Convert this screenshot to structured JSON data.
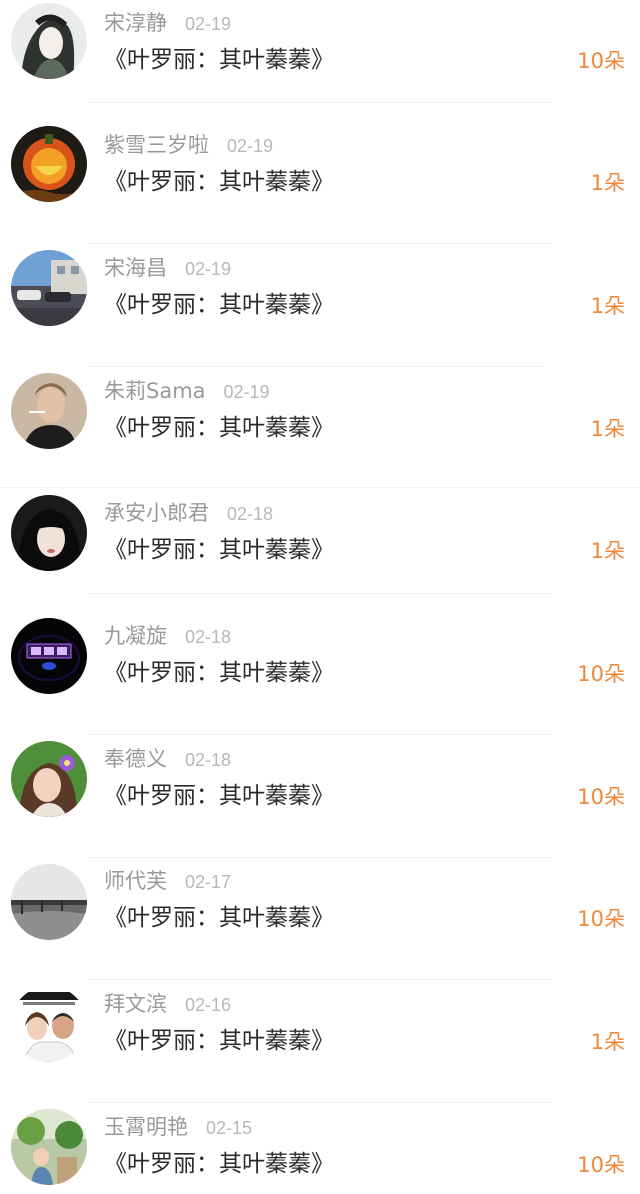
{
  "items": [
    {
      "name": "宋淳静",
      "date": "02-19",
      "title": "《叶罗丽：其叶蓁蓁》",
      "amount": "10朵",
      "avatar": "avatar-girl-illustration-icon"
    },
    {
      "name": "紫雪三岁啦",
      "date": "02-19",
      "title": "《叶罗丽：其叶蓁蓁》",
      "amount": "1朵",
      "avatar": "avatar-pumpkin-lantern-icon"
    },
    {
      "name": "宋海昌",
      "date": "02-19",
      "title": "《叶罗丽：其叶蓁蓁》",
      "amount": "1朵",
      "avatar": "avatar-cars-building-icon"
    },
    {
      "name": "朱莉Sama",
      "date": "02-19",
      "title": "《叶罗丽：其叶蓁蓁》",
      "amount": "1朵",
      "avatar": "avatar-woman-smoking-icon"
    },
    {
      "name": "承安小郎君",
      "date": "02-18",
      "title": "《叶罗丽：其叶蓁蓁》",
      "amount": "1朵",
      "avatar": "avatar-dark-hair-girl-icon"
    },
    {
      "name": "九凝旋",
      "date": "02-18",
      "title": "《叶罗丽：其叶蓁蓁》",
      "amount": "10朵",
      "avatar": "avatar-neon-sign-icon"
    },
    {
      "name": "奉德义",
      "date": "02-18",
      "title": "《叶罗丽：其叶蓁蓁》",
      "amount": "10朵",
      "avatar": "avatar-woman-flower-icon"
    },
    {
      "name": "师代芙",
      "date": "02-17",
      "title": "《叶罗丽：其叶蓁蓁》",
      "amount": "10朵",
      "avatar": "avatar-bridge-landscape-icon"
    },
    {
      "name": "拜文滨",
      "date": "02-16",
      "title": "《叶罗丽：其叶蓁蓁》",
      "amount": "1朵",
      "avatar": "avatar-couple-poster-icon"
    },
    {
      "name": "玉霄明艳",
      "date": "02-15",
      "title": "《叶罗丽：其叶蓁蓁》",
      "amount": "10朵",
      "avatar": "avatar-child-plants-icon"
    }
  ],
  "colors": {
    "name": "#9a9a9a",
    "date": "#b8b8b8",
    "title": "#2b2b2b",
    "amount": "#f0883a",
    "divider": "#f0f0f0"
  }
}
